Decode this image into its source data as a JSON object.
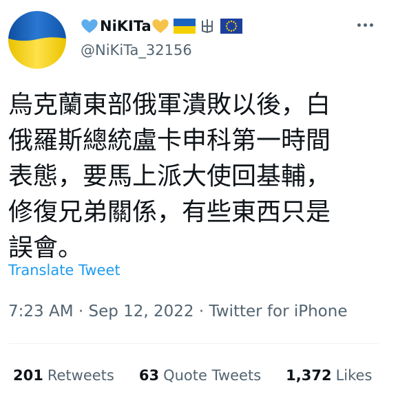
{
  "author": {
    "display_name": "NiKITa",
    "name_emojis": [
      "blue-heart-icon",
      "yellow-heart-icon",
      "ukraine-flag-icon",
      "tryzub-icon",
      "eu-flag-icon"
    ],
    "handle": "@NiKiTa_32156",
    "avatar": "ukraine-flag-avatar"
  },
  "tweet": {
    "text_lines": [
      "烏克蘭東部俄軍潰敗以後，白",
      "俄羅斯總統盧卡申科第一時間",
      "表態，要馬上派大使回基輔，",
      "修復兄弟關係，有些東西只是",
      "誤會。"
    ],
    "translate_label": "Translate Tweet",
    "time": "7:23 AM",
    "date": "Sep 12, 2022",
    "source": "Twitter for iPhone",
    "separator": "·"
  },
  "stats": {
    "retweets_count": "201",
    "retweets_label": "Retweets",
    "quotes_count": "63",
    "quotes_label": "Quote Tweets",
    "likes_count": "1,372",
    "likes_label": "Likes"
  },
  "colors": {
    "text": "#0f1419",
    "secondary": "#536471",
    "link": "#1d9bf0",
    "flag_blue": "#1a64c0",
    "flag_yellow": "#f5d000",
    "heart_blue": "#5dadec",
    "heart_yellow": "#f6c34a",
    "eu_blue": "#1d3f9c",
    "divider": "#eff3f4"
  },
  "more_icon": "more-horizontal-icon"
}
